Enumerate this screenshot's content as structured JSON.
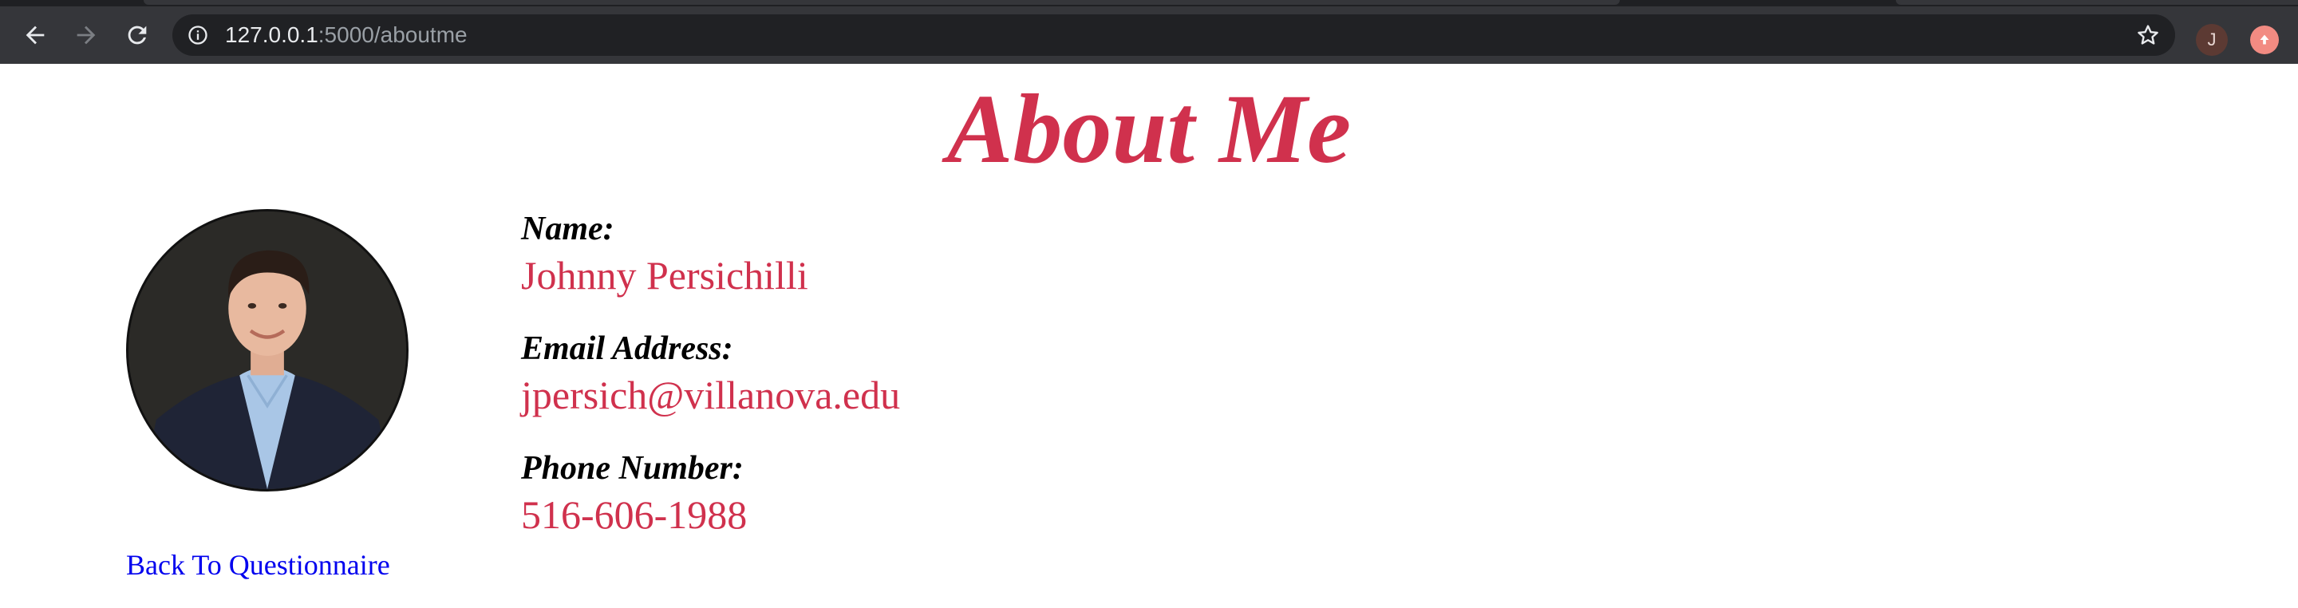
{
  "browser": {
    "url_host": "127.0.0.1",
    "url_path": ":5000/aboutme",
    "profile_initial": "J",
    "icons": {
      "back": "back-arrow-icon",
      "forward": "forward-arrow-icon",
      "reload": "reload-icon",
      "site_info": "info-icon",
      "bookmark": "star-icon",
      "update": "update-arrow-icon"
    }
  },
  "page": {
    "title": "About Me",
    "photo": "profile-photo",
    "fields": [
      {
        "label": "Name:",
        "value": "Johnny Persichilli"
      },
      {
        "label": "Email Address:",
        "value": "jpersich@villanova.edu"
      },
      {
        "label": "Phone Number:",
        "value": "516-606-1988"
      }
    ],
    "back_link": "Back To Questionnaire"
  },
  "colors": {
    "accent": "#d0314d",
    "link": "#0000ee",
    "chrome_toolbar": "#35363a",
    "omnibox": "#202124"
  }
}
